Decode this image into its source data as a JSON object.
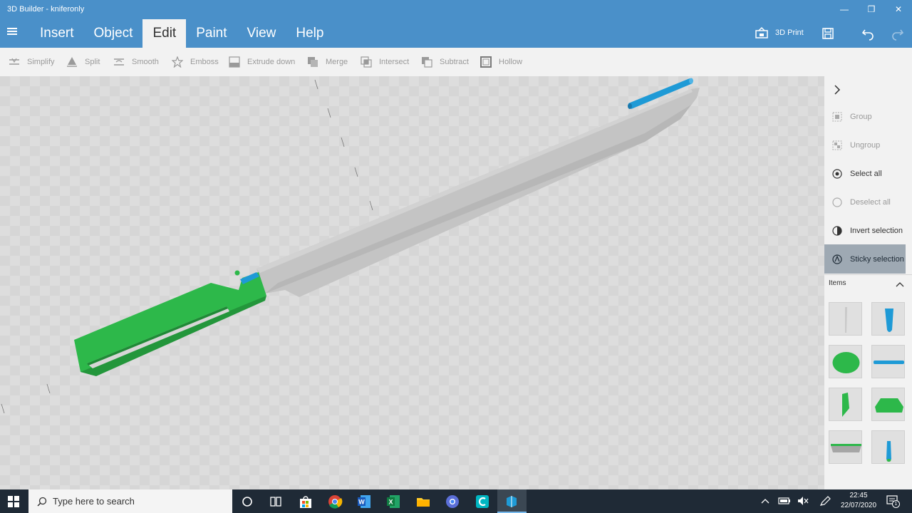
{
  "window": {
    "title": "3D Builder - kniferonly",
    "minimize": "—",
    "maximize": "❐",
    "close": "✕"
  },
  "menu": {
    "items": [
      "Insert",
      "Object",
      "Edit",
      "Paint",
      "View",
      "Help"
    ],
    "active": "Edit",
    "print_label": "3D Print"
  },
  "toolbar": {
    "tools": [
      {
        "label": "Simplify",
        "icon": "simplify-icon"
      },
      {
        "label": "Split",
        "icon": "split-icon"
      },
      {
        "label": "Smooth",
        "icon": "smooth-icon"
      },
      {
        "label": "Emboss",
        "icon": "star-icon"
      },
      {
        "label": "Extrude down",
        "icon": "extrude-down-icon"
      },
      {
        "label": "Merge",
        "icon": "merge-icon"
      },
      {
        "label": "Intersect",
        "icon": "intersect-icon"
      },
      {
        "label": "Subtract",
        "icon": "subtract-icon"
      },
      {
        "label": "Hollow",
        "icon": "hollow-icon"
      }
    ]
  },
  "panel": {
    "actions": [
      {
        "label": "Group",
        "state": "disabled"
      },
      {
        "label": "Ungroup",
        "state": "disabled"
      },
      {
        "label": "Select all",
        "state": "enabled"
      },
      {
        "label": "Deselect all",
        "state": "disabled"
      },
      {
        "label": "Invert selection",
        "state": "enabled"
      },
      {
        "label": "Sticky selection",
        "state": "selected"
      }
    ],
    "items_label": "Items"
  },
  "taskbar": {
    "search_placeholder": "Type here to search",
    "time": "22:45",
    "date": "22/07/2020",
    "notification_count": "1"
  },
  "colors": {
    "accent": "#4a90c9",
    "green_part": "#2db84a",
    "blue_part": "#1e9ad6",
    "blade": "#c4c4c4"
  }
}
